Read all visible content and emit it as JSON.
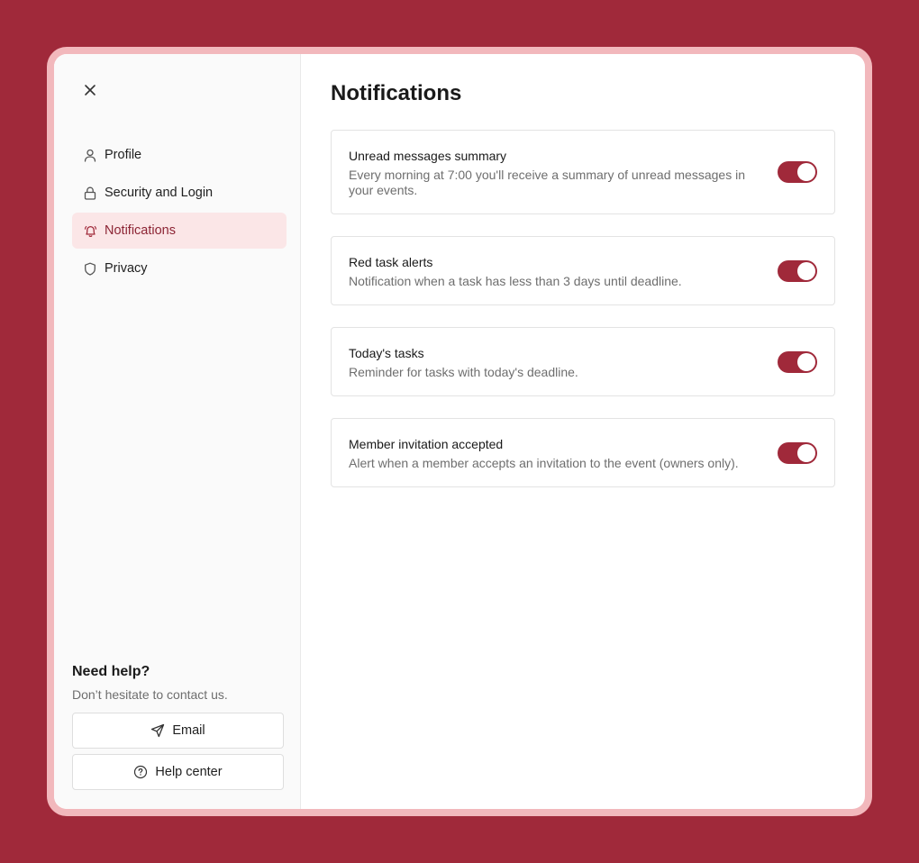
{
  "sidebar": {
    "nav": [
      {
        "label": "Profile",
        "icon": "user-icon",
        "active": false
      },
      {
        "label": "Security and Login",
        "icon": "lock-icon",
        "active": false
      },
      {
        "label": "Notifications",
        "icon": "bell-icon",
        "active": true
      },
      {
        "label": "Privacy",
        "icon": "shield-icon",
        "active": false
      }
    ],
    "help": {
      "title": "Need help?",
      "subtitle": "Don’t hesitate to contact us.",
      "email_label": "Email",
      "help_center_label": "Help center"
    }
  },
  "main": {
    "title": "Notifications",
    "settings": [
      {
        "title": "Unread messages summary",
        "description": "Every morning at 7:00 you'll receive a summary of unread messages in your events.",
        "enabled": true
      },
      {
        "title": "Red task alerts",
        "description": "Notification when a task has less than 3 days until deadline.",
        "enabled": true
      },
      {
        "title": "Today's tasks",
        "description": "Reminder for tasks with today's deadline.",
        "enabled": true
      },
      {
        "title": "Member invitation accepted",
        "description": "Alert when a member accepts an invitation to the event (owners only).",
        "enabled": true
      }
    ]
  },
  "colors": {
    "background": "#a0293a",
    "accent": "#a0293a",
    "active_nav_bg": "#fbe6e7",
    "frame": "#f2b8bc"
  }
}
